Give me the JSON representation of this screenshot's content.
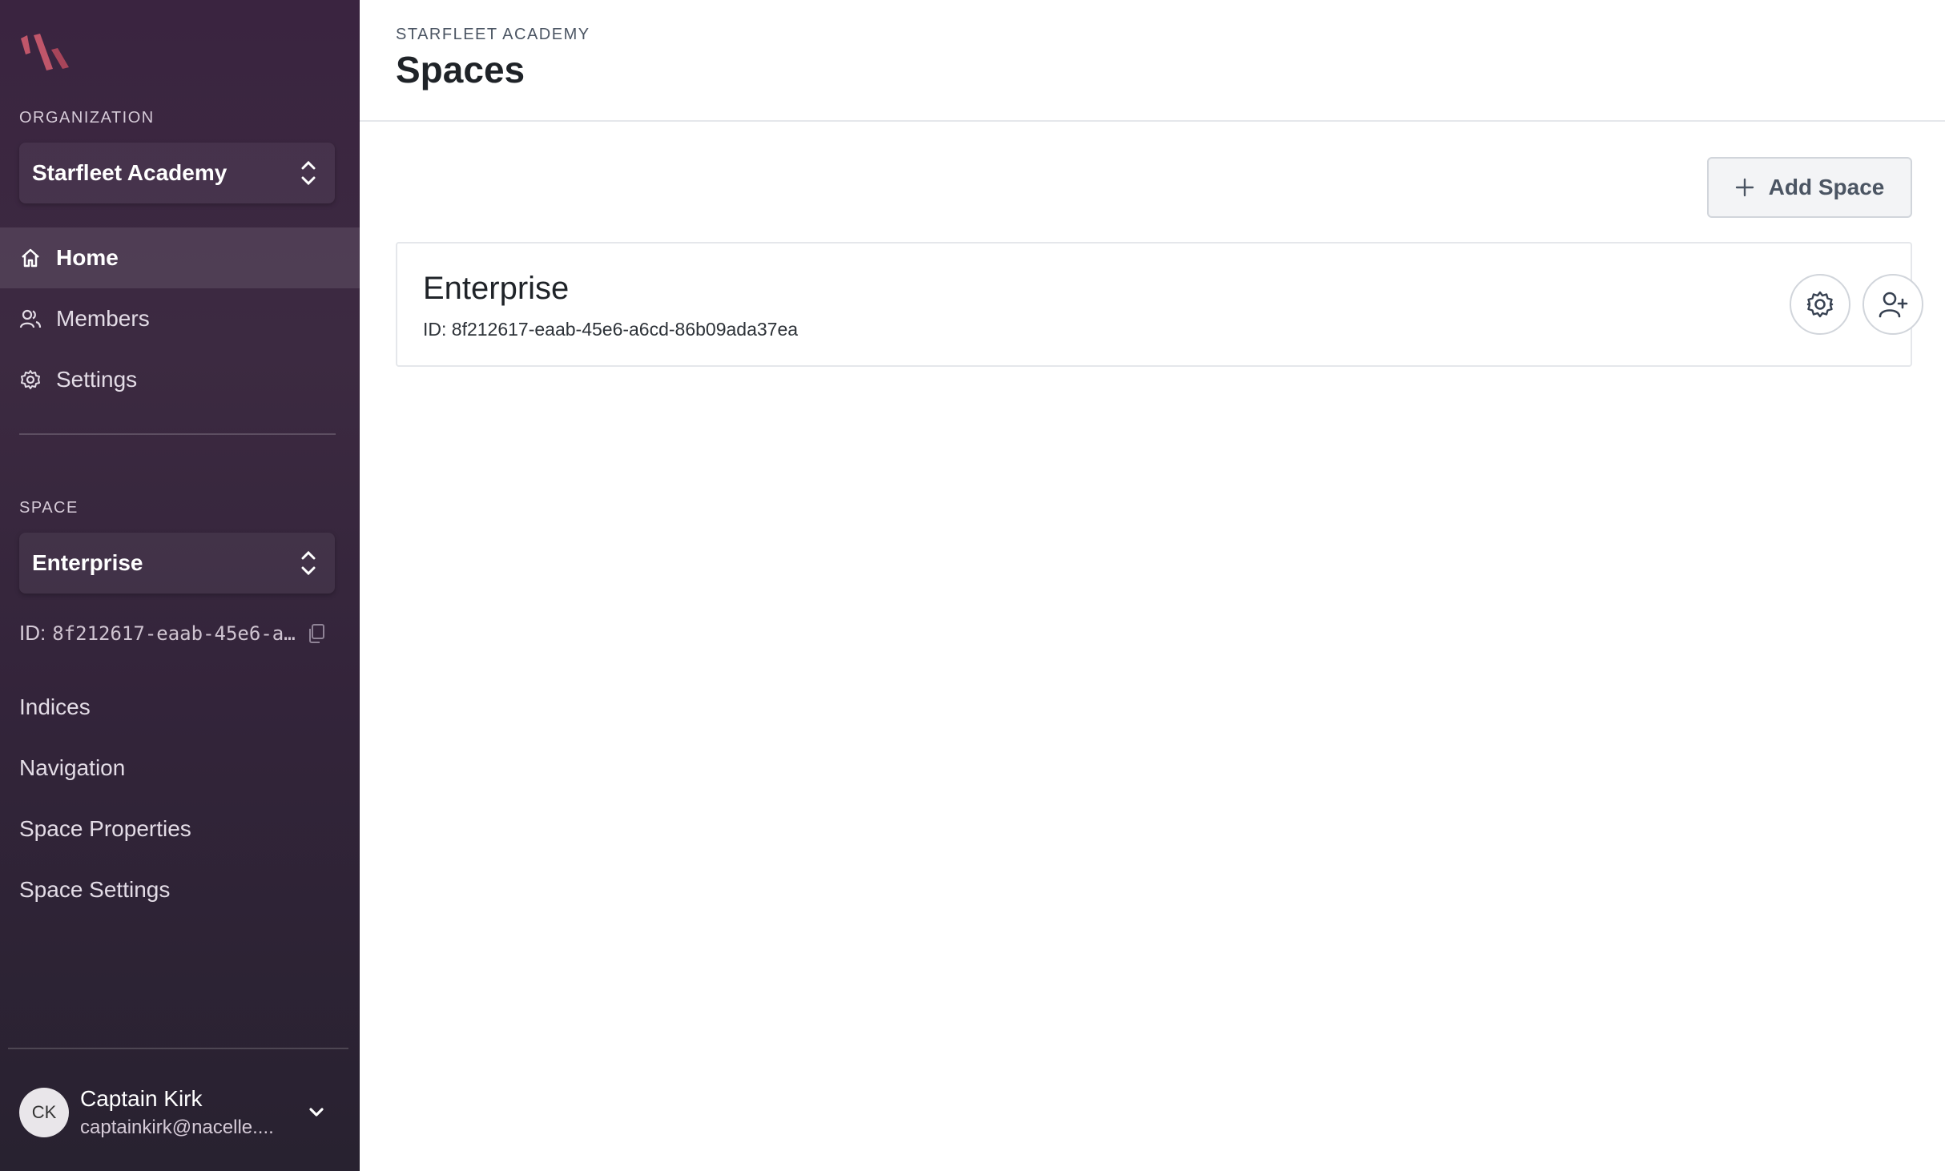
{
  "sidebar": {
    "org_label": "ORGANIZATION",
    "org_name": "Starfleet Academy",
    "nav": [
      {
        "label": "Home",
        "icon": "home-icon"
      },
      {
        "label": "Members",
        "icon": "users-icon"
      },
      {
        "label": "Settings",
        "icon": "gear-icon"
      }
    ],
    "space_label": "SPACE",
    "space_name": "Enterprise",
    "space_id_prefix": "ID:",
    "space_id": "8f212617-eaab-45e6-a…",
    "space_items": [
      "Indices",
      "Navigation",
      "Space Properties",
      "Space Settings"
    ],
    "user": {
      "initials": "CK",
      "name": "Captain Kirk",
      "email": "captainkirk@nacelle...."
    }
  },
  "header": {
    "breadcrumb": "STARFLEET ACADEMY",
    "title": "Spaces"
  },
  "main": {
    "add_button": "Add Space",
    "spaces": [
      {
        "name": "Enterprise",
        "id_text": "ID: 8f212617-eaab-45e6-a6cd-86b09ada37ea"
      }
    ]
  },
  "colors": {
    "sidebar_top": "#3a2440",
    "sidebar_bottom": "#282230",
    "logo_accent": "#c0566a"
  }
}
